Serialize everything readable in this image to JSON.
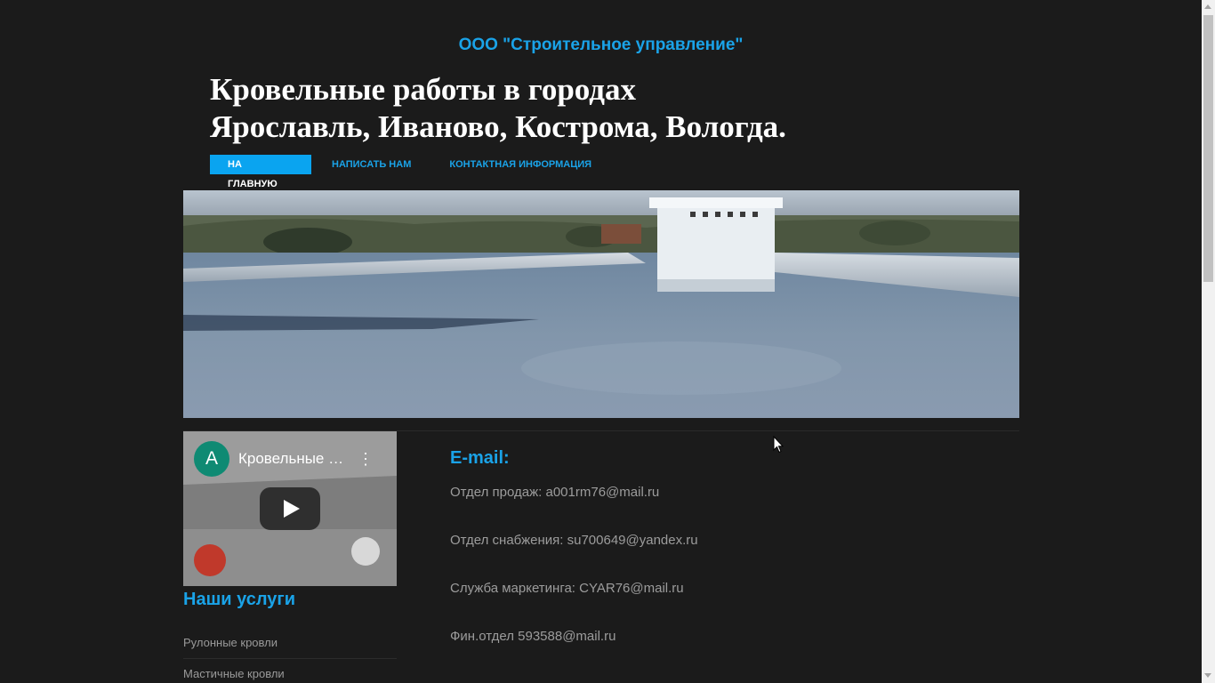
{
  "header": {
    "company": "ООО \"Строительное управление\"",
    "headline_line1": "Кровельные работы в городах",
    "headline_line2": "Ярославль, Иваново, Кострома, Вологда."
  },
  "nav": {
    "items": [
      {
        "label": "На главную",
        "active": true
      },
      {
        "label": "Написать нам",
        "active": false
      },
      {
        "label": "Контактная информация",
        "active": false
      }
    ]
  },
  "video": {
    "channel_initial": "A",
    "title": "Кровельные работы Ярославль",
    "menu_icon": "more-vert-icon",
    "play_icon": "play-icon"
  },
  "services": {
    "title": "Наши услуги",
    "items": [
      "Рулонные кровли",
      "Мастичные кровли"
    ]
  },
  "contacts": {
    "title": "E-mail:",
    "lines": [
      "Отдел продаж: a001rm76@mail.ru",
      "Отдел снабжения: su700649@yandex.ru",
      "Служба маркетинга: CYAR76@mail.ru",
      "Фин.отдел 593588@mail.ru"
    ]
  },
  "colors": {
    "background": "#1b1b1b",
    "accent": "#1aa3e8",
    "nav_active_bg": "#0aa4f0",
    "heading": "#ffffff",
    "body_text": "#9c9c9c"
  }
}
